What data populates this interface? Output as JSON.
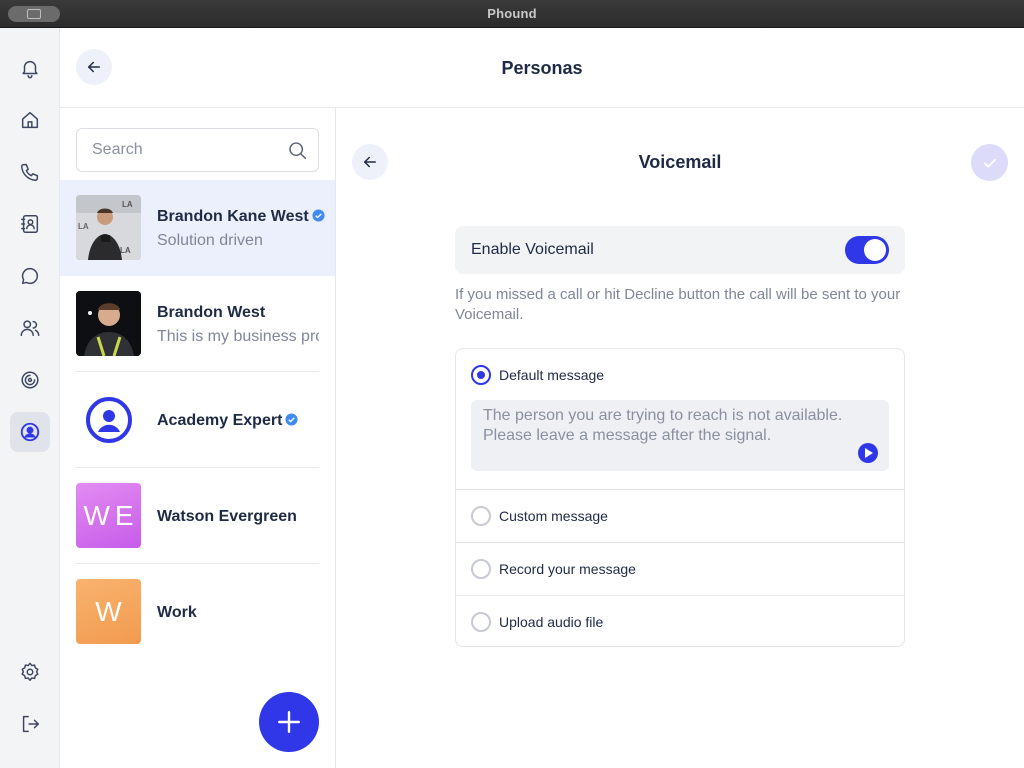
{
  "window": {
    "title": "Phound"
  },
  "rail": {
    "items": [
      {
        "icon": "bell-icon"
      },
      {
        "icon": "home-icon"
      },
      {
        "icon": "phone-icon"
      },
      {
        "icon": "contacts-icon"
      },
      {
        "icon": "chat-icon"
      },
      {
        "icon": "people-icon"
      },
      {
        "icon": "phound-logo-icon"
      },
      {
        "icon": "persona-icon",
        "active": true
      },
      {
        "icon": "gear-icon"
      },
      {
        "icon": "logout-icon"
      }
    ]
  },
  "header": {
    "title": "Personas"
  },
  "search": {
    "placeholder": "Search"
  },
  "personas": [
    {
      "name": "Brandon Kane West",
      "subtitle": "Solution driven",
      "verified": true,
      "selected": true,
      "avatar": "photo"
    },
    {
      "name": "Brandon West",
      "subtitle": "This is my business profile",
      "verified": false,
      "avatar": "photo"
    },
    {
      "name": "Academy Expert",
      "subtitle": "",
      "verified": true,
      "avatar": "logo"
    },
    {
      "name": "Watson Evergreen",
      "subtitle": "",
      "verified": false,
      "avatar": "initials",
      "initials": "WE",
      "color": "#d46cf0"
    },
    {
      "name": "Work",
      "subtitle": "",
      "verified": false,
      "avatar": "initials",
      "initials": "W",
      "color": "#f6a35a"
    }
  ],
  "detail": {
    "title": "Voicemail",
    "enable_label": "Enable Voicemail",
    "enabled": true,
    "hint": "If you missed a call or hit Decline button the call will be sent to your Voicemail.",
    "options": [
      {
        "label": "Default message",
        "selected": true
      },
      {
        "label": "Custom message",
        "selected": false
      },
      {
        "label": "Record your message",
        "selected": false
      },
      {
        "label": "Upload audio file",
        "selected": false
      }
    ],
    "default_text": "The person you are trying to reach is not available. Please leave a message after the signal."
  },
  "colors": {
    "accent": "#2f37e8",
    "sidebar_bg": "#f3f4f6",
    "selected_row": "#ecf0fc"
  }
}
